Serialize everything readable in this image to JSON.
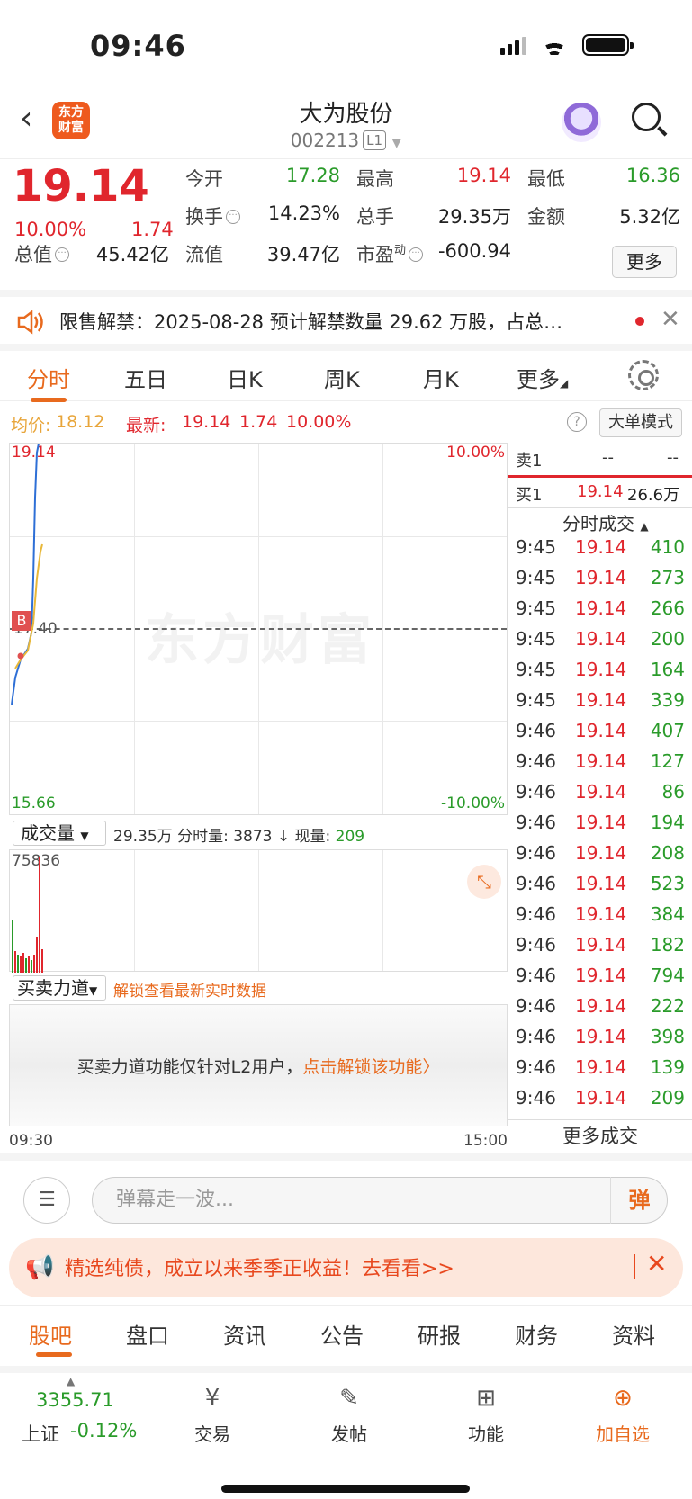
{
  "status_bar": {
    "time": "09:46"
  },
  "header": {
    "logo_text": "东方\n财富",
    "title": "大为股份",
    "code": "002213",
    "level_badge": "L1"
  },
  "quote": {
    "price": "19.14",
    "change_pct": "10.00%",
    "change": "1.74",
    "open_label": "今开",
    "open": "17.28",
    "high_label": "最高",
    "high": "19.14",
    "low_label": "最低",
    "low": "16.36",
    "turnover_label": "换手",
    "turnover": "14.23%",
    "volume_label": "总手",
    "volume": "29.35万",
    "amount_label": "金额",
    "amount": "5.32亿",
    "mktcap_label": "总值",
    "mktcap": "45.42亿",
    "float_label": "流值",
    "float": "39.47亿",
    "pe_label": "市盈",
    "pe_sup": "动",
    "pe": "-600.94",
    "more_label": "更多"
  },
  "notice": {
    "text": "限售解禁：2025-08-28 预计解禁数量 29.62 万股，占总…"
  },
  "chart_tabs": [
    "分时",
    "五日",
    "日K",
    "周K",
    "月K",
    "更多"
  ],
  "info": {
    "avg_label": "均价:",
    "avg": "18.12",
    "last_label": "最新:",
    "last": "19.14",
    "last_chg": "1.74",
    "last_pct": "10.00%",
    "big_mode": "大单模式"
  },
  "chart_labels": {
    "top_price": "19.14",
    "top_pct": "10.00%",
    "bottom_price": "15.66",
    "bottom_pct": "-10.00%",
    "mid_price": "17.40",
    "watermark": "东方财富",
    "b_marker": "B"
  },
  "volume_bar": {
    "selector": "成交量",
    "text": "29.35万 分时量: 3873 ↓ 现量: ",
    "current": "209",
    "max_label": "75836"
  },
  "force_bar": {
    "selector": "买卖力道",
    "link": "解锁查看最新实时数据",
    "lock_text": "买卖力道功能仅针对L2用户，",
    "lock_link": "点击解锁该功能〉"
  },
  "time_axis": {
    "start": "09:30",
    "end": "15:00"
  },
  "order_book": {
    "sell1_label": "卖1",
    "sell1_price": "--",
    "sell1_vol": "--",
    "buy1_label": "买1",
    "buy1_price": "19.14",
    "buy1_vol": "26.6万",
    "trades_header": "分时成交",
    "trades": [
      {
        "t": "9:45",
        "p": "19.14",
        "v": "410"
      },
      {
        "t": "9:45",
        "p": "19.14",
        "v": "273"
      },
      {
        "t": "9:45",
        "p": "19.14",
        "v": "266"
      },
      {
        "t": "9:45",
        "p": "19.14",
        "v": "200"
      },
      {
        "t": "9:45",
        "p": "19.14",
        "v": "164"
      },
      {
        "t": "9:45",
        "p": "19.14",
        "v": "339"
      },
      {
        "t": "9:46",
        "p": "19.14",
        "v": "407"
      },
      {
        "t": "9:46",
        "p": "19.14",
        "v": "127"
      },
      {
        "t": "9:46",
        "p": "19.14",
        "v": "86"
      },
      {
        "t": "9:46",
        "p": "19.14",
        "v": "194"
      },
      {
        "t": "9:46",
        "p": "19.14",
        "v": "208"
      },
      {
        "t": "9:46",
        "p": "19.14",
        "v": "523"
      },
      {
        "t": "9:46",
        "p": "19.14",
        "v": "384"
      },
      {
        "t": "9:46",
        "p": "19.14",
        "v": "182"
      },
      {
        "t": "9:46",
        "p": "19.14",
        "v": "794"
      },
      {
        "t": "9:46",
        "p": "19.14",
        "v": "222"
      },
      {
        "t": "9:46",
        "p": "19.14",
        "v": "398"
      },
      {
        "t": "9:46",
        "p": "19.14",
        "v": "139"
      },
      {
        "t": "9:46",
        "p": "19.14",
        "v": "209"
      }
    ],
    "more_trades": "更多成交"
  },
  "danmu": {
    "placeholder": "弹幕走一波...",
    "button": "弹"
  },
  "ad": {
    "text": "精选纯债，成立以来季季正收益！去看看>>"
  },
  "bottom_tabs": [
    "股吧",
    "盘口",
    "资讯",
    "公告",
    "研报",
    "财务",
    "资料"
  ],
  "bottom_nav": {
    "index_value": "3355.71",
    "index_name": "上证",
    "index_pct": "-0.12%",
    "items": [
      "交易",
      "发帖",
      "功能",
      "加自选"
    ]
  },
  "colors": {
    "up": "#e0262d",
    "down": "#2a9b2a",
    "accent": "#e86a1e"
  }
}
